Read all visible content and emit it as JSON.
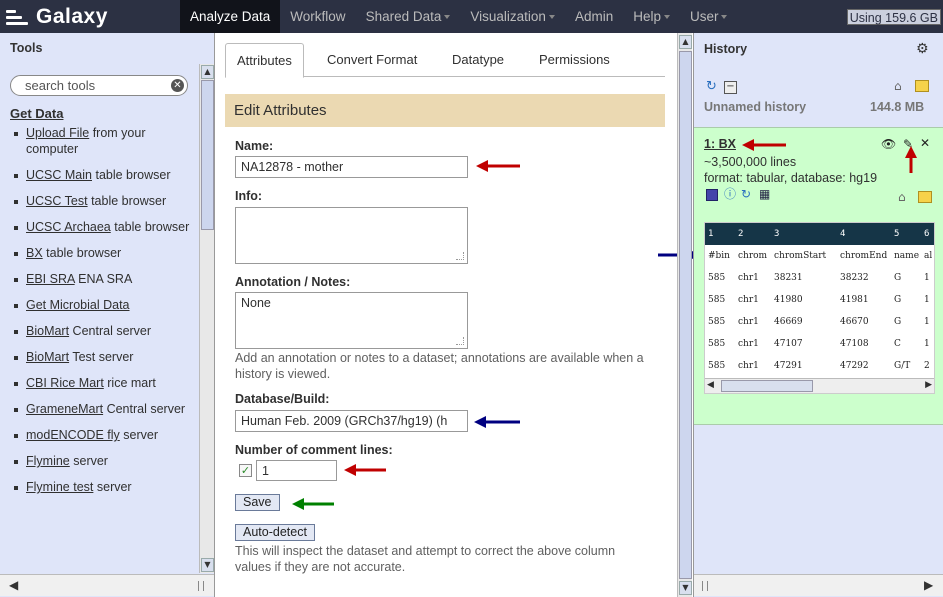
{
  "masthead": {
    "brand": "Galaxy",
    "tabs": [
      {
        "label": "Analyze Data",
        "active": true,
        "dropdown": false
      },
      {
        "label": "Workflow",
        "active": false,
        "dropdown": false
      },
      {
        "label": "Shared Data",
        "active": false,
        "dropdown": true
      },
      {
        "label": "Visualization",
        "active": false,
        "dropdown": true
      },
      {
        "label": "Admin",
        "active": false,
        "dropdown": false
      },
      {
        "label": "Help",
        "active": false,
        "dropdown": true
      },
      {
        "label": "User",
        "active": false,
        "dropdown": true
      }
    ],
    "quota": "Using 159.6 GB"
  },
  "tools": {
    "title": "Tools",
    "search_placeholder": "search tools",
    "section": "Get Data",
    "items": [
      {
        "link": "Upload File",
        "rest": " from your computer"
      },
      {
        "link": "UCSC Main",
        "rest": " table browser"
      },
      {
        "link": "UCSC Test",
        "rest": " table browser"
      },
      {
        "link": "UCSC Archaea",
        "rest": " table browser"
      },
      {
        "link": "BX",
        "rest": " table browser"
      },
      {
        "link": "EBI SRA",
        "rest": " ENA SRA"
      },
      {
        "link": "Get Microbial Data",
        "rest": ""
      },
      {
        "link": "BioMart",
        "rest": " Central server"
      },
      {
        "link": "BioMart",
        "rest": " Test server"
      },
      {
        "link": "CBI Rice Mart",
        "rest": " rice mart"
      },
      {
        "link": "GrameneMart",
        "rest": " Central server"
      },
      {
        "link": "modENCODE fly",
        "rest": " server"
      },
      {
        "link": "Flymine",
        "rest": " server"
      },
      {
        "link": "Flymine test",
        "rest": " server"
      }
    ]
  },
  "center": {
    "tabs": [
      "Attributes",
      "Convert Format",
      "Datatype",
      "Permissions"
    ],
    "header": "Edit Attributes",
    "name_label": "Name:",
    "name_value": "NA12878 - mother",
    "info_label": "Info:",
    "info_value": "",
    "annotation_label": "Annotation / Notes:",
    "annotation_value": "None",
    "annotation_help": "Add an annotation or notes to a dataset; annotations are available when a history is viewed.",
    "dbkey_label": "Database/Build:",
    "dbkey_value": "Human Feb. 2009 (GRCh37/hg19) (h",
    "comment_label": "Number of comment lines:",
    "comment_value": "1",
    "save_label": "Save",
    "autodetect_label": "Auto-detect",
    "autodetect_help": "This will inspect the dataset and attempt to correct the above column values if they are not accurate."
  },
  "history": {
    "title": "History",
    "name": "Unnamed history",
    "size": "144.8 MB",
    "dataset": {
      "title": "1: BX",
      "lines": "~3,500,000 lines",
      "meta": "format: tabular, database: hg19",
      "peek_header": [
        "1",
        "2",
        "3",
        "4",
        "5",
        "6"
      ],
      "peek_rows": [
        [
          "#bin",
          "chrom",
          "chromStart",
          "chromEnd",
          "name",
          "al"
        ],
        [
          "585",
          "chr1",
          "38231",
          "38232",
          "G",
          "1"
        ],
        [
          "585",
          "chr1",
          "41980",
          "41981",
          "G",
          "1"
        ],
        [
          "585",
          "chr1",
          "46669",
          "46670",
          "G",
          "1"
        ],
        [
          "585",
          "chr1",
          "47107",
          "47108",
          "C",
          "1"
        ],
        [
          "585",
          "chr1",
          "47291",
          "47292",
          "G/T",
          "2"
        ]
      ]
    }
  },
  "colors": {
    "masthead": "#2c3143",
    "panel_bg": "#dfe5f9",
    "edit_header": "#ebd9b2",
    "dataset_ok": "#ccffcc",
    "arrow_red": "#c00000",
    "arrow_blue": "#000080",
    "arrow_green": "#008000"
  }
}
